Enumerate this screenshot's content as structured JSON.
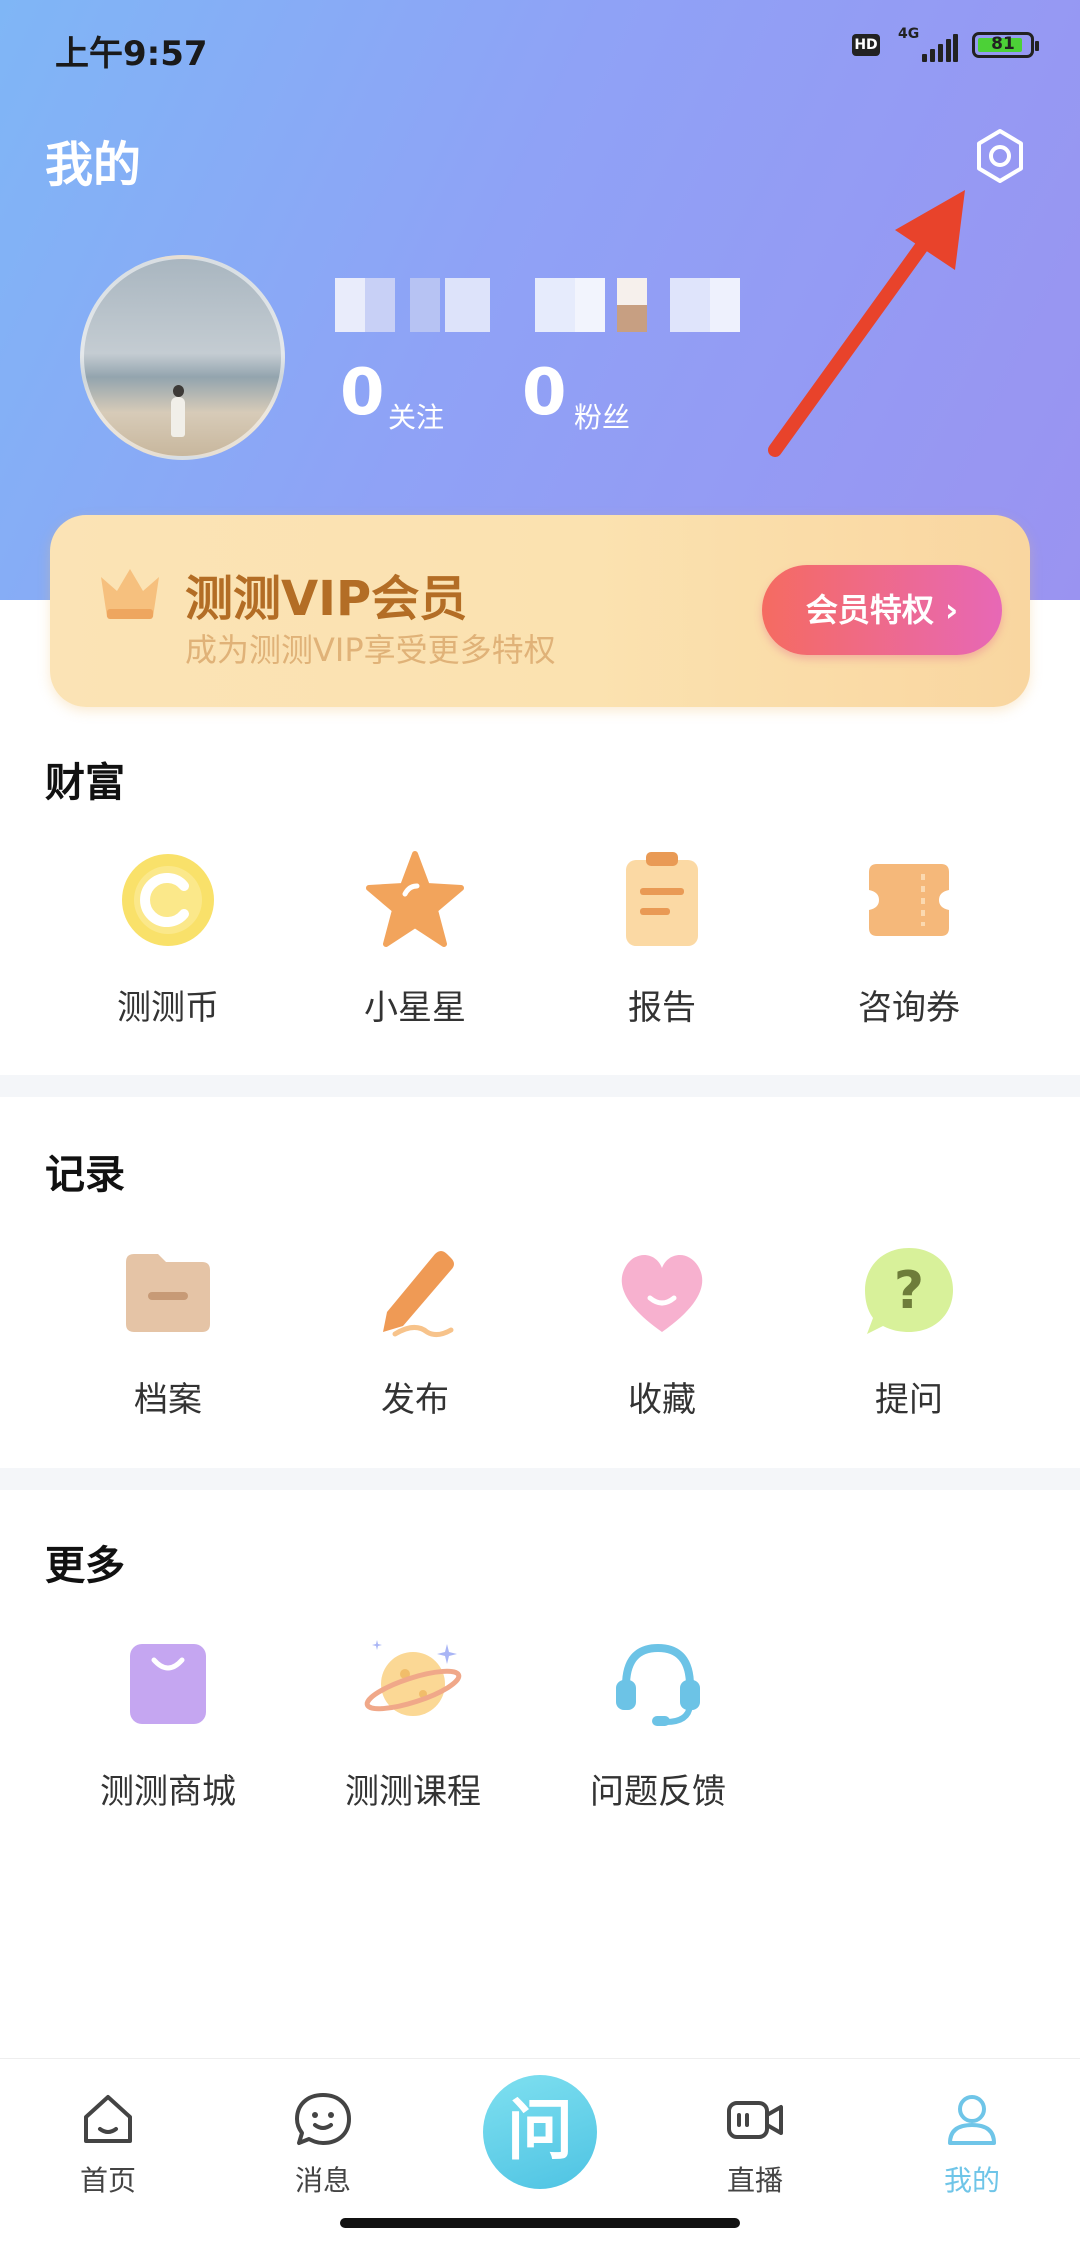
{
  "status_bar": {
    "time": "上午9:57",
    "hd": "HD",
    "network": "4G",
    "battery": "81"
  },
  "header": {
    "title": "我的"
  },
  "profile": {
    "following_count": "0",
    "following_label": "关注",
    "followers_count": "0",
    "followers_label": "粉丝"
  },
  "vip": {
    "title": "测测VIP会员",
    "subtitle": "成为测测VIP享受更多特权",
    "button": "会员特权 ›"
  },
  "wealth": {
    "title": "财富",
    "items": [
      {
        "label": "测测币"
      },
      {
        "label": "小星星"
      },
      {
        "label": "报告"
      },
      {
        "label": "咨询券"
      }
    ]
  },
  "records": {
    "title": "记录",
    "items": [
      {
        "label": "档案"
      },
      {
        "label": "发布"
      },
      {
        "label": "收藏"
      },
      {
        "label": "提问"
      }
    ]
  },
  "more": {
    "title": "更多",
    "items": [
      {
        "label": "测测商城"
      },
      {
        "label": "测测课程"
      },
      {
        "label": "问题反馈"
      }
    ]
  },
  "tabbar": {
    "items": [
      {
        "label": "首页"
      },
      {
        "label": "消息"
      },
      {
        "label": "问"
      },
      {
        "label": "直播"
      },
      {
        "label": "我的"
      }
    ],
    "active_color": "#6fc5e8"
  },
  "colors": {
    "accent": "#6fc5e8",
    "vip_text": "#b36d25",
    "arrow": "#e8432b"
  }
}
